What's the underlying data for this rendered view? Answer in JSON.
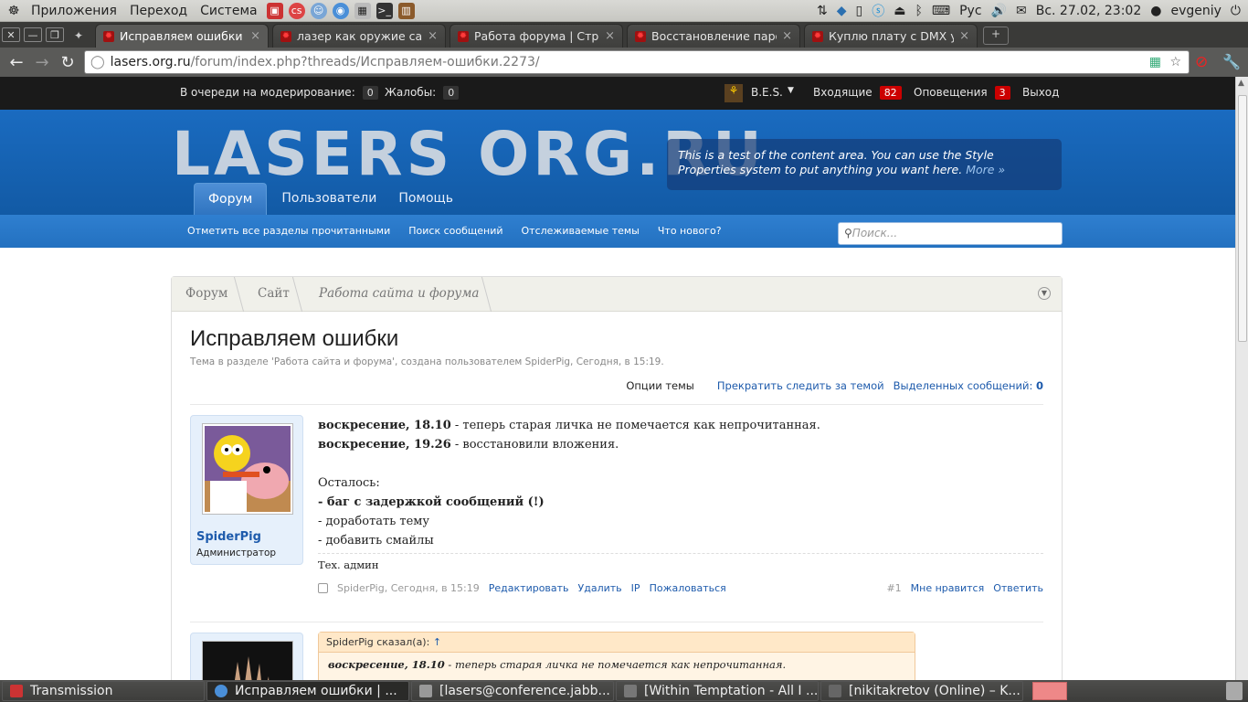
{
  "panel": {
    "apps": "Приложения",
    "places": "Переход",
    "system": "Система",
    "keyboard": "Рус",
    "datetime": "Вс. 27.02, 23:02",
    "user": "evgeniy"
  },
  "tabs": [
    {
      "title": "Исправляем ошибки | ...",
      "active": true
    },
    {
      "title": "лазер как оружие само..."
    },
    {
      "title": "Работа форума | Стран..."
    },
    {
      "title": "Восстановление паро..."
    },
    {
      "title": "Куплю плату с DMX уп..."
    }
  ],
  "address": {
    "host": "lasers.org.ru",
    "path": "/forum/index.php?threads/Исправляем-ошибки.2273/"
  },
  "modbar": {
    "queue_label": "В очереди на модерирование:",
    "queue_count": "0",
    "complaints_label": "Жалобы:",
    "complaints_count": "0",
    "user": "B.E.S.",
    "inbox": "Входящие",
    "inbox_count": "82",
    "alerts": "Оповещения",
    "alerts_count": "3",
    "logout": "Выход"
  },
  "header": {
    "logo": "LASERS ORG.RU",
    "promo": "This is a test of the content area. You can use the Style Properties system to put anything you want here.",
    "promo_more": "More »"
  },
  "nav": {
    "forum": "Форум",
    "users": "Пользователи",
    "help": "Помощь"
  },
  "subnav": {
    "mark_read": "Отметить все разделы прочитанными",
    "search_posts": "Поиск сообщений",
    "watched": "Отслеживаемые темы",
    "whats_new": "Что нового?",
    "search_placeholder": "Поиск..."
  },
  "breadcrumbs": [
    "Форум",
    "Сайт",
    "Работа сайта и форума"
  ],
  "thread": {
    "title": "Исправляем ошибки",
    "subtitle": "Тема в разделе 'Работа сайта и форума', создана пользователем SpiderPig, Сегодня, в 15:19.",
    "options": "Опции темы",
    "unwatch": "Прекратить следить за темой",
    "selected": "Выделенных сообщений:",
    "selected_count": "0"
  },
  "post1": {
    "user": "SpiderPig",
    "role": "Администратор",
    "line1_b": "воскресение, 18.10",
    "line1": " - теперь старая личка не помечается как непрочитанная.",
    "line2_b": "воскресение, 19.26",
    "line2": " - восстановили вложения.",
    "left": "Осталось:",
    "todo1": "- баг с задержкой сообщений (!)",
    "todo2": "- доработать тему",
    "todo3": "- добавить смайлы",
    "signature": "Тех. админ",
    "meta": "SpiderPig, Сегодня, в 15:19",
    "edit": "Редактировать",
    "delete": "Удалить",
    "ip": "IP",
    "report": "Пожаловаться",
    "num": "#1",
    "like": "Мне нравится",
    "reply": "Ответить"
  },
  "post2": {
    "quote_head": "SpiderPig сказал(а):",
    "quote_arrow": "↑",
    "quote_b": "воскресение, 18.10",
    "quote_text": " - теперь старая личка не помечается как непрочитанная."
  },
  "taskbar": [
    "Transmission",
    "Исправляем ошибки | ...",
    "[lasers@conference.jabb...",
    "[Within Temptation - All I ...",
    "[nikitakretov (Online) – K..."
  ]
}
